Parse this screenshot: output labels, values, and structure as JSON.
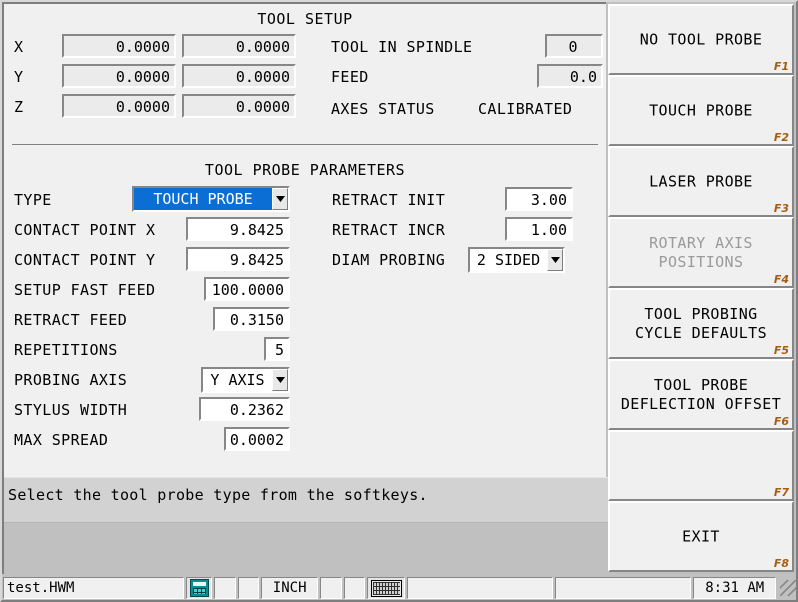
{
  "tool_setup": {
    "title": "TOOL SETUP",
    "axes": [
      {
        "label": "X",
        "machine": "0.0000",
        "program": "0.0000"
      },
      {
        "label": "Y",
        "machine": "0.0000",
        "program": "0.0000"
      },
      {
        "label": "Z",
        "machine": "0.0000",
        "program": "0.0000"
      }
    ],
    "tool_in_spindle_label": "TOOL IN SPINDLE",
    "tool_in_spindle_value": "0",
    "feed_label": "FEED",
    "feed_value": "0.0",
    "axes_status_label": "AXES STATUS",
    "axes_status_value": "CALIBRATED"
  },
  "probe_params": {
    "title": "TOOL PROBE PARAMETERS",
    "type_label": "TYPE",
    "type_value": "TOUCH PROBE",
    "contact_point_x_label": "CONTACT POINT X",
    "contact_point_x_value": "9.8425",
    "contact_point_y_label": "CONTACT POINT Y",
    "contact_point_y_value": "9.8425",
    "setup_fast_feed_label": "SETUP FAST FEED",
    "setup_fast_feed_value": "100.0000",
    "retract_feed_label": "RETRACT FEED",
    "retract_feed_value": "0.3150",
    "repetitions_label": "REPETITIONS",
    "repetitions_value": "5",
    "probing_axis_label": "PROBING AXIS",
    "probing_axis_value": "Y AXIS",
    "stylus_width_label": "STYLUS WIDTH",
    "stylus_width_value": "0.2362",
    "max_spread_label": "MAX SPREAD",
    "max_spread_value": "0.0002",
    "retract_init_label": "RETRACT INIT",
    "retract_init_value": "3.00",
    "retract_incr_label": "RETRACT INCR",
    "retract_incr_value": "1.00",
    "diam_probing_label": "DIAM PROBING",
    "diam_probing_value": "2 SIDED"
  },
  "message": {
    "text": "Select the tool probe type from the softkeys."
  },
  "softkeys": [
    {
      "label": "NO TOOL PROBE",
      "fkey": "F1",
      "enabled": true
    },
    {
      "label": "TOUCH PROBE",
      "fkey": "F2",
      "enabled": true
    },
    {
      "label": "LASER PROBE",
      "fkey": "F3",
      "enabled": true
    },
    {
      "label": "ROTARY AXIS\nPOSITIONS",
      "fkey": "F4",
      "enabled": false
    },
    {
      "label": "TOOL PROBING\nCYCLE DEFAULTS",
      "fkey": "F5",
      "enabled": true
    },
    {
      "label": "TOOL PROBE\nDEFLECTION OFFSET",
      "fkey": "F6",
      "enabled": true
    },
    {
      "label": "",
      "fkey": "F7",
      "enabled": true
    },
    {
      "label": "EXIT",
      "fkey": "F8",
      "enabled": true
    }
  ],
  "status_bar": {
    "filename": "test.HWM",
    "calculator_icon": "calculator-icon",
    "units": "INCH",
    "keyboard_icon": "keyboard-icon",
    "clock": "8:31 AM"
  },
  "colors": {
    "selection_blue": "#0b6ed4",
    "fkey_orange": "#a85c10",
    "face": "#c0c0c0",
    "client": "#f0f0f0"
  }
}
